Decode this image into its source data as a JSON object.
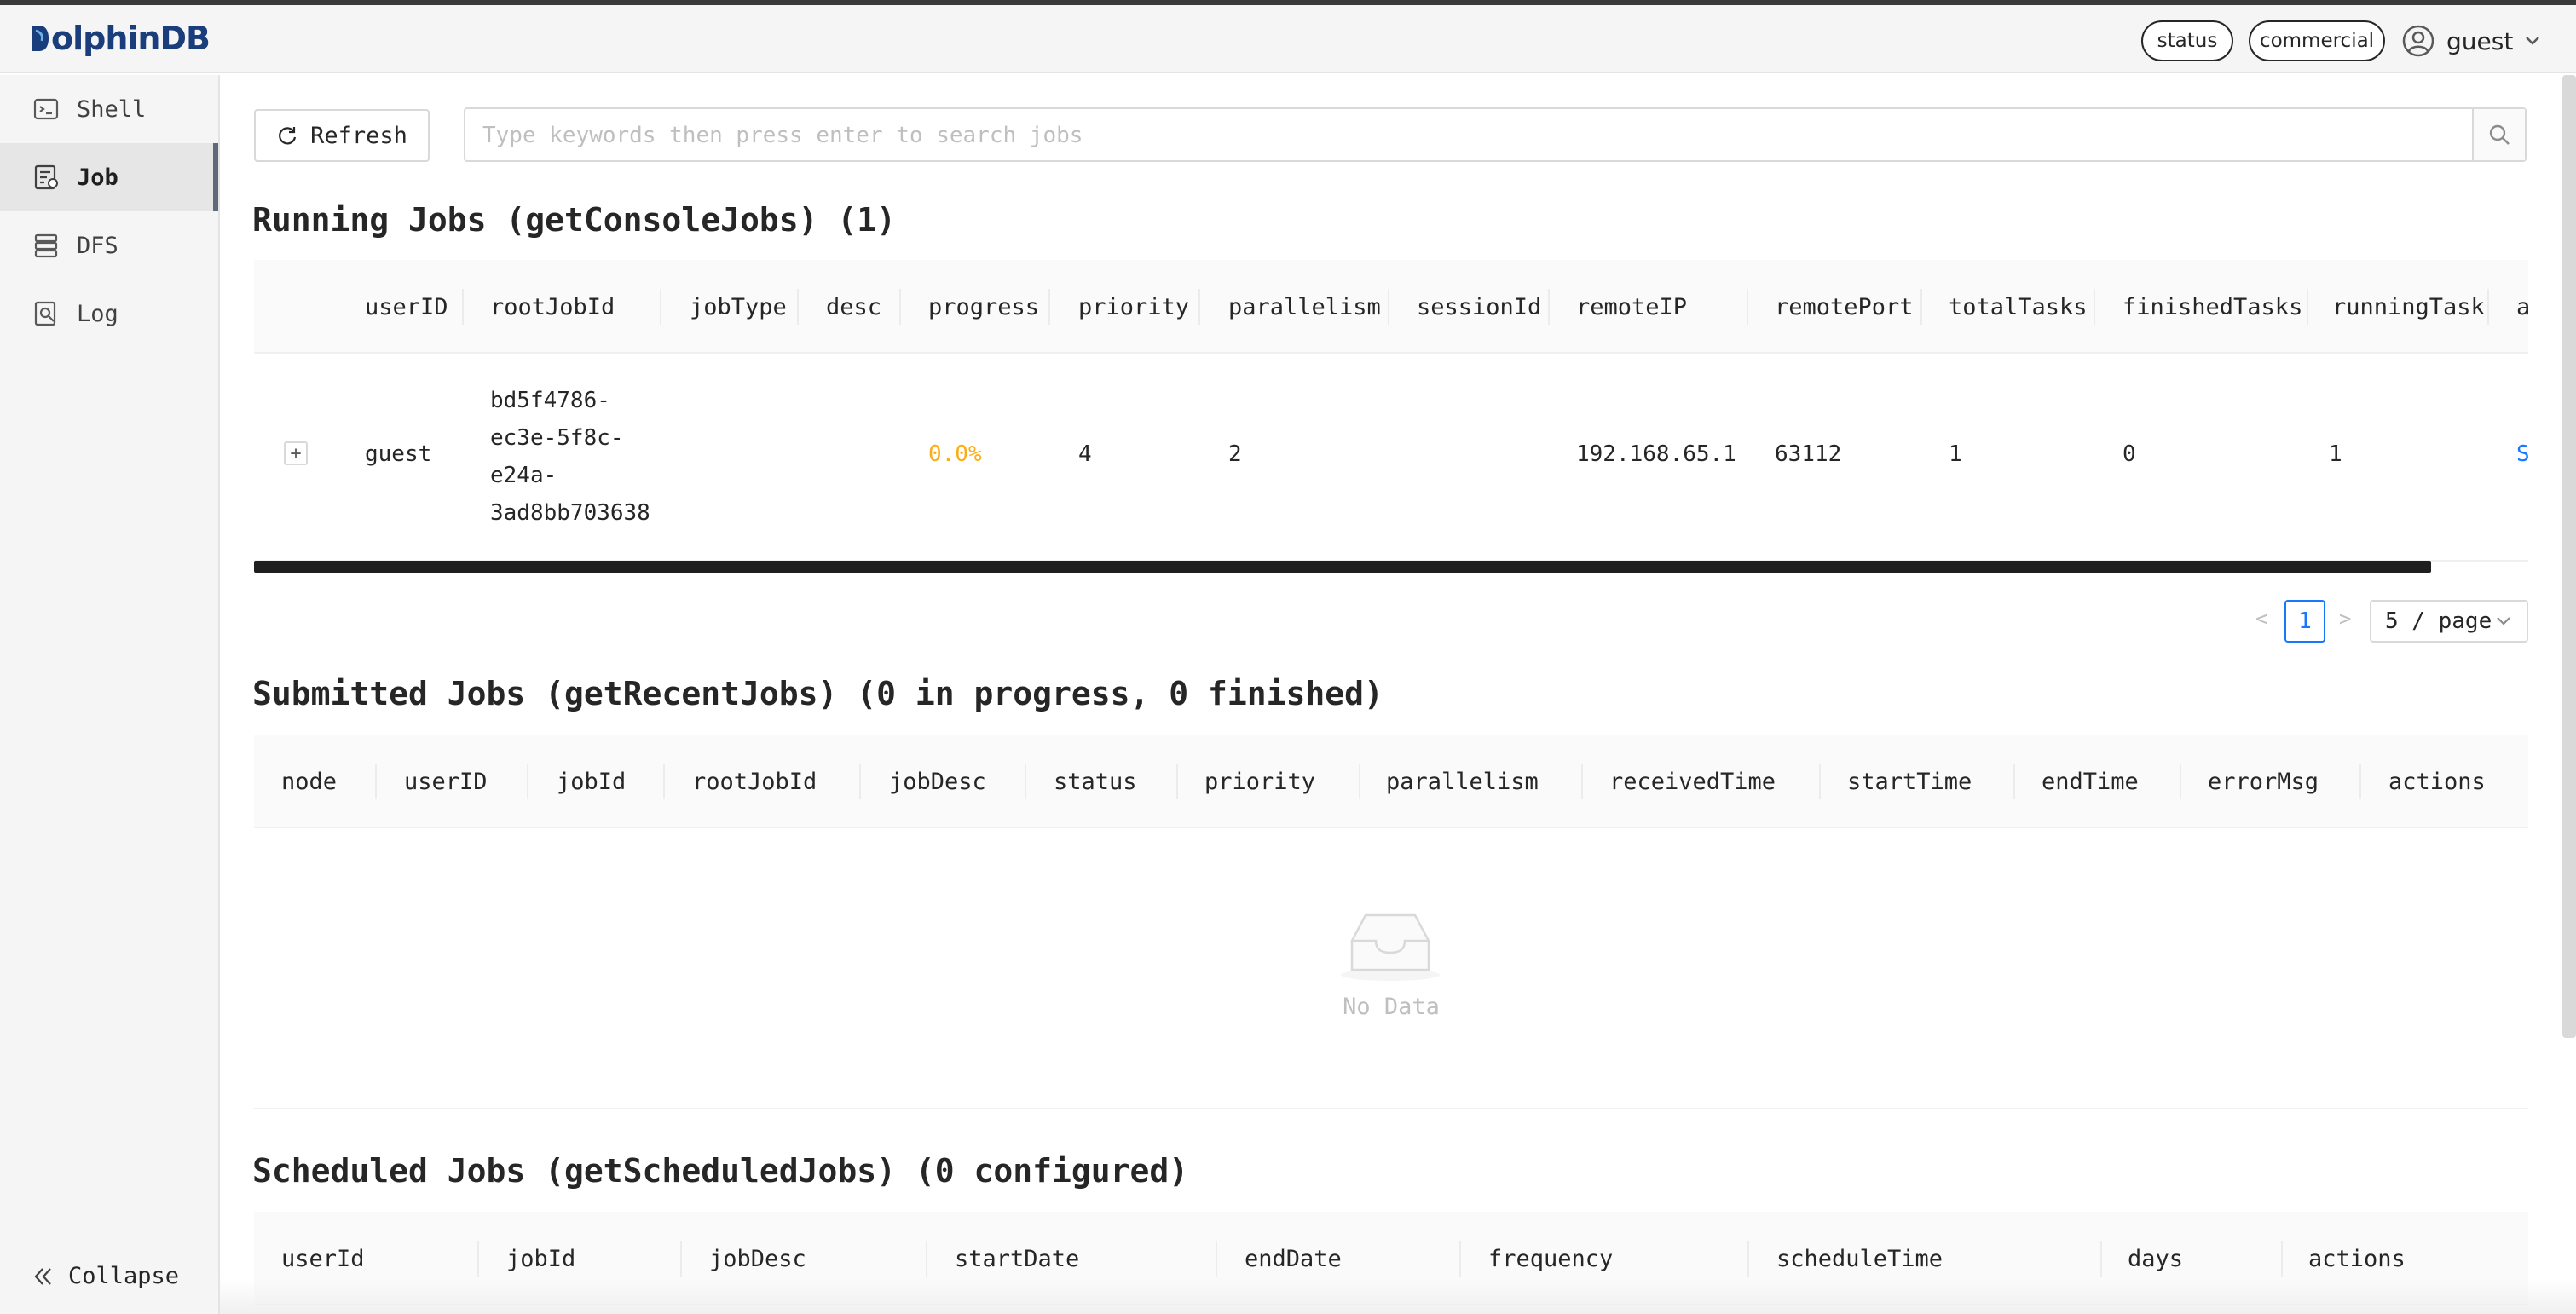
{
  "app": {
    "logo_text": "olphinDB",
    "logo_initial": "D"
  },
  "header": {
    "status_btn": "status",
    "commercial_btn": "commercial",
    "user": "guest"
  },
  "sidebar": {
    "items": [
      {
        "label": "Shell",
        "icon": "shell-icon"
      },
      {
        "label": "Job",
        "icon": "job-icon"
      },
      {
        "label": "DFS",
        "icon": "dfs-icon"
      },
      {
        "label": "Log",
        "icon": "log-icon"
      }
    ],
    "collapse_label": "Collapse"
  },
  "toolbar": {
    "refresh_label": "Refresh",
    "search_placeholder": "Type keywords then press enter to search jobs"
  },
  "running": {
    "title": "Running Jobs (getConsoleJobs) (1)",
    "columns": [
      "userID",
      "rootJobId",
      "jobType",
      "desc",
      "progress",
      "priority",
      "parallelism",
      "sessionId",
      "remoteIP",
      "remotePort",
      "totalTasks",
      "finishedTasks",
      "runningTask",
      "a"
    ],
    "rows": [
      {
        "expand": "+",
        "userID": "guest",
        "rootJobId": "bd5f4786-ec3e-5f8c-e24a-3ad8bb703638",
        "rootJobId_lines": [
          "bd5f4786-",
          "ec3e-5f8c-",
          "e24a-",
          "3ad8bb703638"
        ],
        "jobType": "",
        "desc": "",
        "progress": "0.0%",
        "priority": "4",
        "parallelism": "2",
        "sessionId": "",
        "remoteIP": "192.168.65.1",
        "remotePort": "63112",
        "totalTasks": "1",
        "finishedTasks": "0",
        "runningTask": "1",
        "action": "S"
      }
    ],
    "pagination": {
      "prev": "<",
      "page": "1",
      "next": ">",
      "size": "5 / page"
    }
  },
  "submitted": {
    "title": "Submitted Jobs (getRecentJobs) (0 in progress, 0 finished)",
    "columns": [
      "node",
      "userID",
      "jobId",
      "rootJobId",
      "jobDesc",
      "status",
      "priority",
      "parallelism",
      "receivedTime",
      "startTime",
      "endTime",
      "errorMsg",
      "actions"
    ],
    "empty_text": "No Data"
  },
  "scheduled": {
    "title": "Scheduled Jobs (getScheduledJobs) (0 configured)",
    "columns": [
      "userId",
      "jobId",
      "jobDesc",
      "startDate",
      "endDate",
      "frequency",
      "scheduleTime",
      "days",
      "actions"
    ]
  },
  "colors": {
    "accent": "#1677ff",
    "progress": "#faad14",
    "logo": "#1a3d7c"
  }
}
